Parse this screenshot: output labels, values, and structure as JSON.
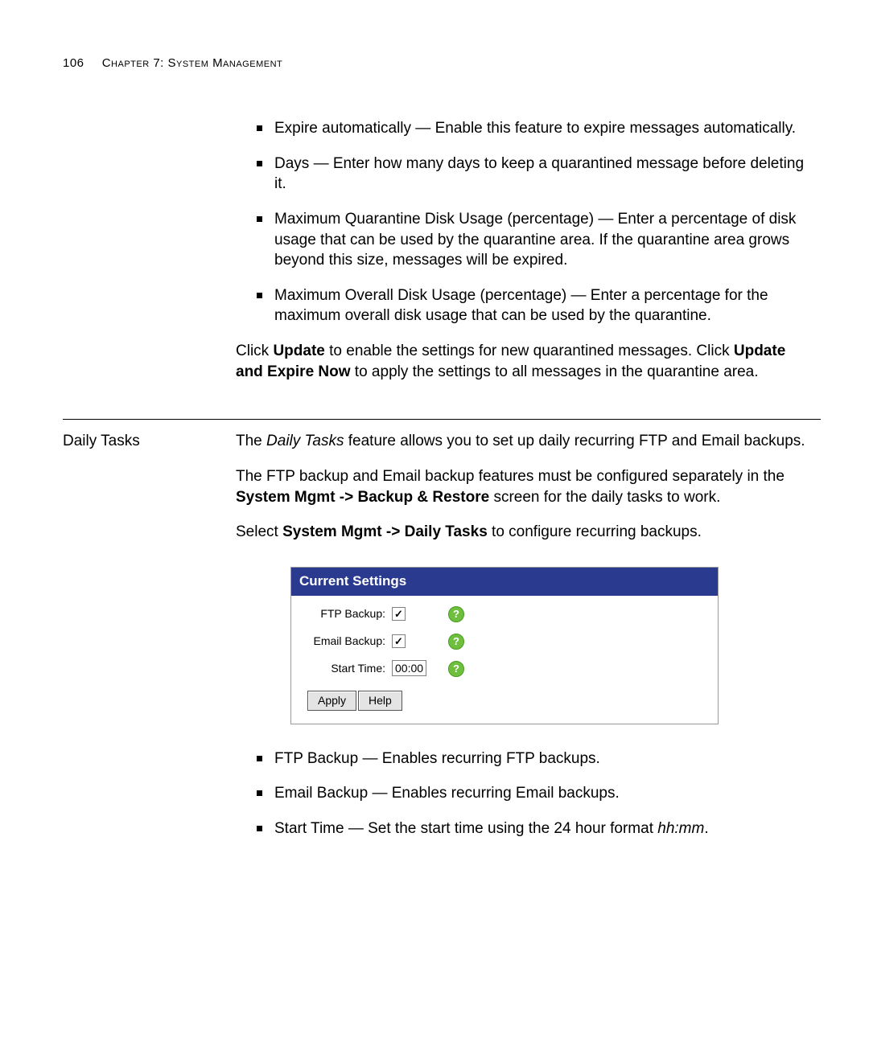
{
  "page_number": "106",
  "chapter_heading": "Chapter 7: System Management",
  "bullets_top": [
    {
      "label": "Expire automatically",
      "desc": " — Enable this feature to expire messages automatically."
    },
    {
      "label": "Days",
      "desc": " — Enter how many days to keep a quarantined message before deleting it."
    },
    {
      "label": "Maximum Quarantine Disk Usage (percentage)",
      "desc": " — Enter a percentage of disk usage that can be used by the quarantine area. If the quarantine area grows beyond this size, messages will be expired."
    },
    {
      "label": "Maximum Overall Disk Usage (percentage)",
      "desc": " — Enter a percentage for the maximum overall disk usage that can be used by the quarantine."
    }
  ],
  "update_para": {
    "pre1": "Click ",
    "b1": "Update",
    "mid1": " to enable the settings for new quarantined messages. Click ",
    "b2": "Update and Expire Now",
    "post": " to apply the settings to all messages in the quarantine area."
  },
  "section_heading": "Daily Tasks",
  "dt_intro": {
    "pre": "The ",
    "ital": "Daily Tasks",
    "post": " feature allows you to set up daily recurring FTP and Email backups."
  },
  "dt_para2": {
    "pre": "The FTP backup and Email backup features must be configured separately in the ",
    "b": "System Mgmt -> Backup & Restore",
    "post": " screen for the daily tasks to work."
  },
  "dt_para3": {
    "pre": "Select ",
    "b": "System Mgmt -> Daily Tasks",
    "post": " to configure recurring backups."
  },
  "shot": {
    "title": "Current Settings",
    "rows": {
      "ftp_label": "FTP Backup:",
      "email_label": "Email Backup:",
      "time_label": "Start Time:",
      "time_value": "00:00"
    },
    "help_glyph": "?",
    "buttons": {
      "apply": "Apply",
      "help": "Help"
    }
  },
  "bullets_bottom": [
    {
      "label": "FTP Backup",
      "desc": " — Enables recurring FTP backups."
    },
    {
      "label": "Email Backup",
      "desc": " — Enables recurring Email backups."
    },
    {
      "label": "Start Time",
      "desc_pre": " — Set the start time using the 24 hour format ",
      "ital": "hh:mm",
      "desc_post": "."
    }
  ]
}
